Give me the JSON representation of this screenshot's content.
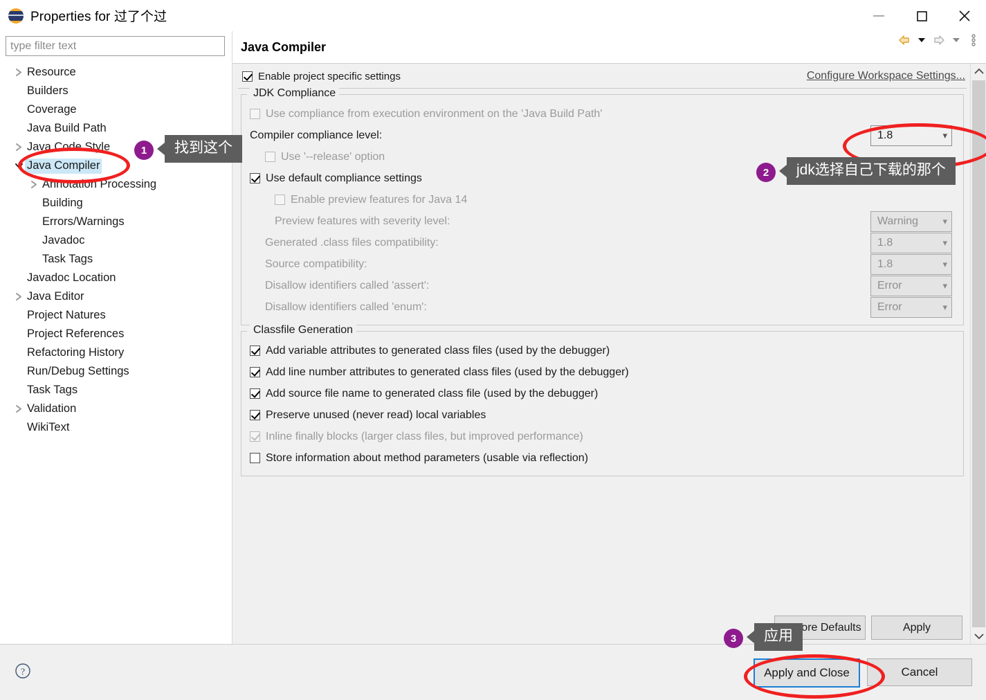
{
  "window": {
    "title": "Properties for 过了个过",
    "icon": "eclipse-globe-icon",
    "minimize_label": "Minimize",
    "maximize_label": "Maximize",
    "close_label": "Close"
  },
  "sidebar": {
    "filter_placeholder": "type filter text",
    "filter_value": "",
    "items": [
      {
        "label": "Resource",
        "indent": 0,
        "arrow": "collapsed",
        "selected": false
      },
      {
        "label": "Builders",
        "indent": 0,
        "arrow": "none",
        "selected": false
      },
      {
        "label": "Coverage",
        "indent": 0,
        "arrow": "none",
        "selected": false
      },
      {
        "label": "Java Build Path",
        "indent": 0,
        "arrow": "none",
        "selected": false
      },
      {
        "label": "Java Code Style",
        "indent": 0,
        "arrow": "collapsed",
        "selected": false
      },
      {
        "label": "Java Compiler",
        "indent": 0,
        "arrow": "expanded",
        "selected": true
      },
      {
        "label": "Annotation Processing",
        "indent": 1,
        "arrow": "collapsed",
        "selected": false
      },
      {
        "label": "Building",
        "indent": 1,
        "arrow": "none",
        "selected": false
      },
      {
        "label": "Errors/Warnings",
        "indent": 1,
        "arrow": "none",
        "selected": false
      },
      {
        "label": "Javadoc",
        "indent": 1,
        "arrow": "none",
        "selected": false
      },
      {
        "label": "Task Tags",
        "indent": 1,
        "arrow": "none",
        "selected": false
      },
      {
        "label": "Javadoc Location",
        "indent": 0,
        "arrow": "none",
        "selected": false
      },
      {
        "label": "Java Editor",
        "indent": 0,
        "arrow": "collapsed",
        "selected": false
      },
      {
        "label": "Project Natures",
        "indent": 0,
        "arrow": "none",
        "selected": false
      },
      {
        "label": "Project References",
        "indent": 0,
        "arrow": "none",
        "selected": false
      },
      {
        "label": "Refactoring History",
        "indent": 0,
        "arrow": "none",
        "selected": false
      },
      {
        "label": "Run/Debug Settings",
        "indent": 0,
        "arrow": "none",
        "selected": false
      },
      {
        "label": "Task Tags",
        "indent": 0,
        "arrow": "none",
        "selected": false
      },
      {
        "label": "Validation",
        "indent": 0,
        "arrow": "collapsed",
        "selected": false
      },
      {
        "label": "WikiText",
        "indent": 0,
        "arrow": "none",
        "selected": false
      }
    ]
  },
  "page": {
    "title": "Java Compiler",
    "toolbar": {
      "back_label": "Back",
      "back_menu_label": "Back history",
      "forward_label": "Forward",
      "forward_menu_label": "Forward history",
      "menu_label": "View menu"
    },
    "enable_specific": {
      "label": "Enable project specific settings",
      "checked": true
    },
    "workspace_link": "Configure Workspace Settings..."
  },
  "jdk_compliance": {
    "title": "JDK Compliance",
    "use_execution_env": {
      "label": "Use compliance from execution environment on the 'Java Build Path'",
      "checked": false,
      "enabled": false,
      "link_text": "Java Build Path"
    },
    "compliance_level": {
      "label": "Compiler compliance level:",
      "value": "1.8",
      "enabled": true
    },
    "use_release": {
      "label": "Use '--release' option",
      "checked": false,
      "enabled": false
    },
    "use_default_settings": {
      "label": "Use default compliance settings",
      "checked": true,
      "enabled": true
    },
    "enable_preview": {
      "label": "Enable preview features for Java 14",
      "checked": false,
      "enabled": false
    },
    "preview_severity": {
      "label": "Preview features with severity level:",
      "value": "Warning",
      "enabled": false
    },
    "class_compat": {
      "label": "Generated .class files compatibility:",
      "value": "1.8",
      "enabled": false
    },
    "source_compat": {
      "label": "Source compatibility:",
      "value": "1.8",
      "enabled": false
    },
    "disallow_assert": {
      "label": "Disallow identifiers called 'assert':",
      "value": "Error",
      "enabled": false
    },
    "disallow_enum": {
      "label": "Disallow identifiers called 'enum':",
      "value": "Error",
      "enabled": false
    }
  },
  "classfile_generation": {
    "title": "Classfile Generation",
    "options": [
      {
        "label": "Add variable attributes to generated class files (used by the debugger)",
        "checked": true,
        "enabled": true
      },
      {
        "label": "Add line number attributes to generated class files (used by the debugger)",
        "checked": true,
        "enabled": true
      },
      {
        "label": "Add source file name to generated class file (used by the debugger)",
        "checked": true,
        "enabled": true
      },
      {
        "label": "Preserve unused (never read) local variables",
        "checked": true,
        "enabled": true
      },
      {
        "label": "Inline finally blocks (larger class files, but improved performance)",
        "checked": true,
        "enabled": false
      },
      {
        "label": "Store information about method parameters (usable via reflection)",
        "checked": false,
        "enabled": true
      }
    ]
  },
  "content_buttons": {
    "restore_defaults": "Restore Defaults",
    "apply": "Apply"
  },
  "footer": {
    "help_icon": "help-question-icon",
    "apply_and_close": "Apply and Close",
    "cancel": "Cancel"
  },
  "annotations": {
    "callouts": [
      {
        "number": "1",
        "text": "找到这个"
      },
      {
        "number": "2",
        "text": "jdk选择自己下载的那个"
      },
      {
        "number": "3",
        "text": "应用"
      }
    ],
    "colors": {
      "highlight_ellipse": "#f02020",
      "badge": "#8e1b8e",
      "tooltip_bg": "#5d5d5d",
      "selection": "#cce8f7",
      "focus_border": "#1a7fd4"
    }
  }
}
